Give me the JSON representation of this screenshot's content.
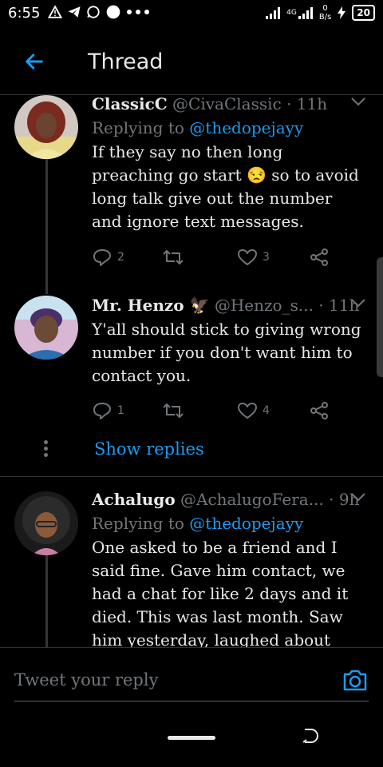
{
  "status_bar": {
    "time": "6:55",
    "network_gen": "4G",
    "net_speed_value": "0",
    "net_speed_unit": "B/s",
    "battery": "20"
  },
  "header": {
    "title": "Thread"
  },
  "tweets": [
    {
      "name": "ClassicC",
      "handle": "@CivaClassic",
      "time": "· 11h",
      "replying_prefix": "Replying to",
      "replying_handle": "@thedopejayy",
      "text": "If they say no then long preaching go start 😒 so to avoid long talk give out the number and ignore text messages.",
      "replies": "2",
      "retweets": "",
      "likes": "3"
    },
    {
      "name": "Mr. Henzo 🦅",
      "handle": "@Henzo_s...",
      "time": "· 11h",
      "text": "Y'all should stick to giving wrong number if you don't want him to contact you.",
      "replies": "1",
      "retweets": "",
      "likes": "4"
    },
    {
      "name": "Achalugo",
      "handle": "@AchalugoFera...",
      "time": "· 9h",
      "replying_prefix": "Replying to",
      "replying_handle": "@thedopejayy",
      "text": "One asked to be a friend and I said fine. Gave him contact, we had a chat for like 2 days and it died. This was last month. Saw him yesterday, laughed about nothing and moved"
    }
  ],
  "show_replies": "Show replies",
  "reply_bar": {
    "placeholder": "Tweet your reply"
  },
  "colors": {
    "accent": "#1d9bf0",
    "background": "#000000",
    "muted": "#71767b"
  }
}
